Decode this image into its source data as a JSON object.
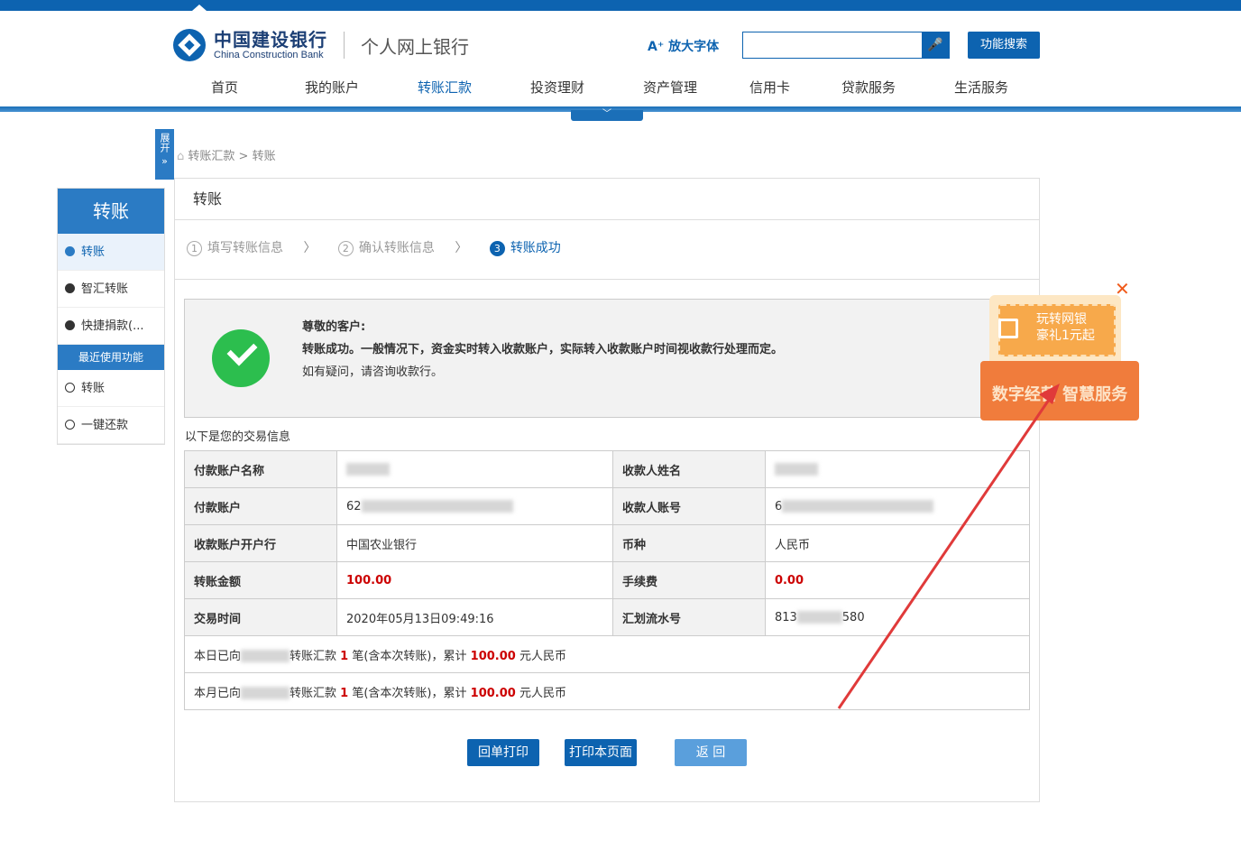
{
  "header": {
    "bank_name_cn": "中国建设银行",
    "bank_name_en": "China Construction Bank",
    "portal": "个人网上银行",
    "zoom_label": "A⁺ 放大字体",
    "search_placeholder": "",
    "func_search": "功能搜索"
  },
  "nav": [
    "首页",
    "我的账户",
    "转账汇款",
    "投资理财",
    "资产管理",
    "信用卡",
    "贷款服务",
    "生活服务"
  ],
  "expand_label": "展开",
  "breadcrumb": "转账汇款 > 转账",
  "sidebar": {
    "title": "转账",
    "items": [
      "转账",
      "智汇转账",
      "快捷捐款(..."
    ],
    "recent_label": "最近使用功能",
    "recent": [
      "转账",
      "一键还款"
    ]
  },
  "main": {
    "title": "转账",
    "steps": [
      {
        "num": "1",
        "label": "填写转账信息"
      },
      {
        "num": "2",
        "label": "确认转账信息"
      },
      {
        "num": "3",
        "label": "转账成功"
      }
    ],
    "greeting": "尊敬的客户:",
    "success_msg": "转账成功。一般情况下，资金实时转入收款账户，实际转入收款账户时间视收款行处理而定。",
    "contact": "如有疑问，请咨询收款行。",
    "info_label": "以下是您的交易信息",
    "rows": [
      {
        "k1": "付款账户名称",
        "v1": "",
        "k2": "收款人姓名",
        "v2": ""
      },
      {
        "k1": "付款账户",
        "v1": "62",
        "k2": "收款人账号",
        "v2": "6"
      },
      {
        "k1": "收款账户开户行",
        "v1": "中国农业银行",
        "k2": "币种",
        "v2": "人民币"
      },
      {
        "k1": "转账金额",
        "v1": "100.00",
        "k2": "手续费",
        "v2": "0.00"
      },
      {
        "k1": "交易时间",
        "v1": "2020年05月13日09:49:16",
        "k2": "汇划流水号",
        "v2a": "813",
        "v2b": "580"
      }
    ],
    "summary_day": {
      "p1": "本日已向",
      "p2": "转账汇款",
      "n": "1",
      "p3": "笔(含本次转账)，累计",
      "amt": "100.00",
      "p4": "元人民币"
    },
    "summary_month": {
      "p1": "本月已向",
      "p2": "转账汇款",
      "n": "1",
      "p3": "笔(含本次转账)，累计",
      "amt": "100.00",
      "p4": "元人民币"
    },
    "buttons": {
      "print_receipt": "回单打印",
      "print_page": "打印本页面",
      "back": "返 回"
    }
  },
  "promo": {
    "line1": "玩转网银",
    "line2": "豪礼1元起",
    "banner": "数字经营 智慧服务",
    "close": "✕"
  },
  "colors": {
    "brand": "#0d63b0",
    "success": "#2cbe4e",
    "amount": "#cc0000",
    "promo": "#f07c3c",
    "arrow": "#e03a3a"
  }
}
